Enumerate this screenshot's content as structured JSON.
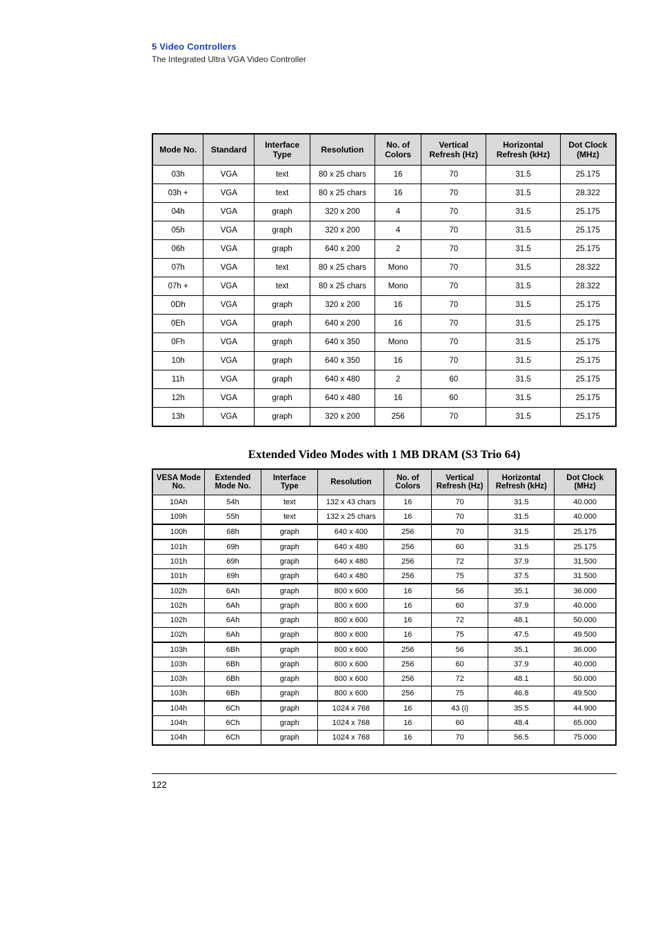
{
  "header": {
    "chapter": "5   Video Controllers",
    "subtitle": "The Integrated Ultra VGA Video Controller"
  },
  "table1": {
    "headers": [
      "Mode No.",
      "Standard",
      "Interface Type",
      "Resolution",
      "No. of Colors",
      "Vertical Refresh (Hz)",
      "Horizontal Refresh (kHz)",
      "Dot Clock (MHz)"
    ],
    "rows": [
      [
        "03h",
        "VGA",
        "text",
        "80 x 25 chars",
        "16",
        "70",
        "31.5",
        "25.175"
      ],
      [
        "03h +",
        "VGA",
        "text",
        "80 x 25 chars",
        "16",
        "70",
        "31.5",
        "28.322"
      ],
      [
        "04h",
        "VGA",
        "graph",
        "320 x 200",
        "4",
        "70",
        "31.5",
        "25.175"
      ],
      [
        "05h",
        "VGA",
        "graph",
        "320 x 200",
        "4",
        "70",
        "31.5",
        "25.175"
      ],
      [
        "06h",
        "VGA",
        "graph",
        "640 x 200",
        "2",
        "70",
        "31.5",
        "25.175"
      ],
      [
        "07h",
        "VGA",
        "text",
        "80 x 25 chars",
        "Mono",
        "70",
        "31.5",
        "28.322"
      ],
      [
        "07h +",
        "VGA",
        "text",
        "80 x 25 chars",
        "Mono",
        "70",
        "31.5",
        "28.322"
      ],
      [
        "0Dh",
        "VGA",
        "graph",
        "320 x 200",
        "16",
        "70",
        "31.5",
        "25.175"
      ],
      [
        "0Eh",
        "VGA",
        "graph",
        "640 x 200",
        "16",
        "70",
        "31.5",
        "25.175"
      ],
      [
        "0Fh",
        "VGA",
        "graph",
        "640 x 350",
        "Mono",
        "70",
        "31.5",
        "25.175"
      ],
      [
        "10h",
        "VGA",
        "graph",
        "640 x 350",
        "16",
        "70",
        "31.5",
        "25.175"
      ],
      [
        "11h",
        "VGA",
        "graph",
        "640 x 480",
        "2",
        "60",
        "31.5",
        "25.175"
      ],
      [
        "12h",
        "VGA",
        "graph",
        "640 x 480",
        "16",
        "60",
        "31.5",
        "25.175"
      ],
      [
        "13h",
        "VGA",
        "graph",
        "320 x 200",
        "256",
        "70",
        "31.5",
        "25.175"
      ]
    ]
  },
  "section_title": "Extended Video Modes with 1 MB DRAM (S3 Trio 64)",
  "table2": {
    "headers": [
      "VESA Mode No.",
      "Extended Mode No.",
      "Interface Type",
      "Resolution",
      "No. of Colors",
      "Vertical Refresh (Hz)",
      "Horizontal Refresh (kHz)",
      "Dot Clock (MHz)"
    ],
    "groups": [
      [
        [
          "10Ah",
          "54h",
          "text",
          "132 x 43 chars",
          "16",
          "70",
          "31.5",
          "40.000"
        ],
        [
          "109h",
          "55h",
          "text",
          "132 x 25 chars",
          "16",
          "70",
          "31.5",
          "40.000"
        ]
      ],
      [
        [
          "100h",
          "68h",
          "graph",
          "640 x 400",
          "256",
          "70",
          "31.5",
          "25.175"
        ]
      ],
      [
        [
          "101h",
          "69h",
          "graph",
          "640 x 480",
          "256",
          "60",
          "31.5",
          "25.175"
        ],
        [
          "101h",
          "69h",
          "graph",
          "640 x 480",
          "256",
          "72",
          "37.9",
          "31.500"
        ],
        [
          "101h",
          "69h",
          "graph",
          "640 x 480",
          "256",
          "75",
          "37.5",
          "31.500"
        ]
      ],
      [
        [
          "102h",
          "6Ah",
          "graph",
          "800 x 600",
          "16",
          "56",
          "35.1",
          "36.000"
        ],
        [
          "102h",
          "6Ah",
          "graph",
          "800 x 600",
          "16",
          "60",
          "37.9",
          "40.000"
        ],
        [
          "102h",
          "6Ah",
          "graph",
          "800 x 600",
          "16",
          "72",
          "48.1",
          "50.000"
        ],
        [
          "102h",
          "6Ah",
          "graph",
          "800 x 600",
          "16",
          "75",
          "47.5",
          "49.500"
        ]
      ],
      [
        [
          "103h",
          "6Bh",
          "graph",
          "800 x 600",
          "256",
          "56",
          "35.1",
          "36.000"
        ],
        [
          "103h",
          "6Bh",
          "graph",
          "800 x 600",
          "256",
          "60",
          "37.9",
          "40.000"
        ],
        [
          "103h",
          "6Bh",
          "graph",
          "800 x 600",
          "256",
          "72",
          "48.1",
          "50.000"
        ],
        [
          "103h",
          "6Bh",
          "graph",
          "800 x 600",
          "256",
          "75",
          "46.8",
          "49.500"
        ]
      ],
      [
        [
          "104h",
          "6Ch",
          "graph",
          "1024 x 768",
          "16",
          "43 (i)",
          "35.5",
          "44.900"
        ],
        [
          "104h",
          "6Ch",
          "graph",
          "1024 x 768",
          "16",
          "60",
          "48.4",
          "65.000"
        ],
        [
          "104h",
          "6Ch",
          "graph",
          "1024 x 768",
          "16",
          "70",
          "56.5",
          "75.000"
        ]
      ]
    ]
  },
  "footer": {
    "page_no": "122"
  }
}
